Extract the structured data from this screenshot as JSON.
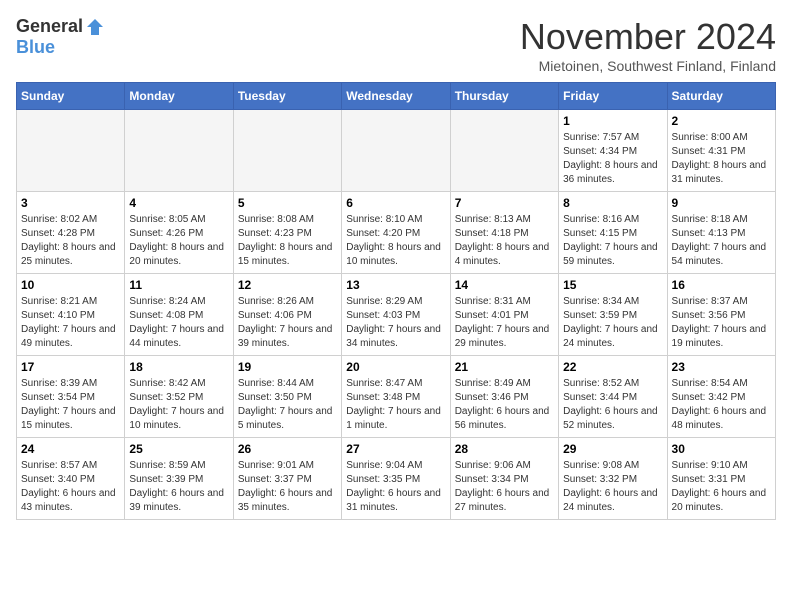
{
  "header": {
    "logo_general": "General",
    "logo_blue": "Blue",
    "month_title": "November 2024",
    "location": "Mietoinen, Southwest Finland, Finland"
  },
  "weekdays": [
    "Sunday",
    "Monday",
    "Tuesday",
    "Wednesday",
    "Thursday",
    "Friday",
    "Saturday"
  ],
  "weeks": [
    [
      {
        "day": "",
        "content": ""
      },
      {
        "day": "",
        "content": ""
      },
      {
        "day": "",
        "content": ""
      },
      {
        "day": "",
        "content": ""
      },
      {
        "day": "",
        "content": ""
      },
      {
        "day": "1",
        "content": "Sunrise: 7:57 AM\nSunset: 4:34 PM\nDaylight: 8 hours and 36 minutes."
      },
      {
        "day": "2",
        "content": "Sunrise: 8:00 AM\nSunset: 4:31 PM\nDaylight: 8 hours and 31 minutes."
      }
    ],
    [
      {
        "day": "3",
        "content": "Sunrise: 8:02 AM\nSunset: 4:28 PM\nDaylight: 8 hours and 25 minutes."
      },
      {
        "day": "4",
        "content": "Sunrise: 8:05 AM\nSunset: 4:26 PM\nDaylight: 8 hours and 20 minutes."
      },
      {
        "day": "5",
        "content": "Sunrise: 8:08 AM\nSunset: 4:23 PM\nDaylight: 8 hours and 15 minutes."
      },
      {
        "day": "6",
        "content": "Sunrise: 8:10 AM\nSunset: 4:20 PM\nDaylight: 8 hours and 10 minutes."
      },
      {
        "day": "7",
        "content": "Sunrise: 8:13 AM\nSunset: 4:18 PM\nDaylight: 8 hours and 4 minutes."
      },
      {
        "day": "8",
        "content": "Sunrise: 8:16 AM\nSunset: 4:15 PM\nDaylight: 7 hours and 59 minutes."
      },
      {
        "day": "9",
        "content": "Sunrise: 8:18 AM\nSunset: 4:13 PM\nDaylight: 7 hours and 54 minutes."
      }
    ],
    [
      {
        "day": "10",
        "content": "Sunrise: 8:21 AM\nSunset: 4:10 PM\nDaylight: 7 hours and 49 minutes."
      },
      {
        "day": "11",
        "content": "Sunrise: 8:24 AM\nSunset: 4:08 PM\nDaylight: 7 hours and 44 minutes."
      },
      {
        "day": "12",
        "content": "Sunrise: 8:26 AM\nSunset: 4:06 PM\nDaylight: 7 hours and 39 minutes."
      },
      {
        "day": "13",
        "content": "Sunrise: 8:29 AM\nSunset: 4:03 PM\nDaylight: 7 hours and 34 minutes."
      },
      {
        "day": "14",
        "content": "Sunrise: 8:31 AM\nSunset: 4:01 PM\nDaylight: 7 hours and 29 minutes."
      },
      {
        "day": "15",
        "content": "Sunrise: 8:34 AM\nSunset: 3:59 PM\nDaylight: 7 hours and 24 minutes."
      },
      {
        "day": "16",
        "content": "Sunrise: 8:37 AM\nSunset: 3:56 PM\nDaylight: 7 hours and 19 minutes."
      }
    ],
    [
      {
        "day": "17",
        "content": "Sunrise: 8:39 AM\nSunset: 3:54 PM\nDaylight: 7 hours and 15 minutes."
      },
      {
        "day": "18",
        "content": "Sunrise: 8:42 AM\nSunset: 3:52 PM\nDaylight: 7 hours and 10 minutes."
      },
      {
        "day": "19",
        "content": "Sunrise: 8:44 AM\nSunset: 3:50 PM\nDaylight: 7 hours and 5 minutes."
      },
      {
        "day": "20",
        "content": "Sunrise: 8:47 AM\nSunset: 3:48 PM\nDaylight: 7 hours and 1 minute."
      },
      {
        "day": "21",
        "content": "Sunrise: 8:49 AM\nSunset: 3:46 PM\nDaylight: 6 hours and 56 minutes."
      },
      {
        "day": "22",
        "content": "Sunrise: 8:52 AM\nSunset: 3:44 PM\nDaylight: 6 hours and 52 minutes."
      },
      {
        "day": "23",
        "content": "Sunrise: 8:54 AM\nSunset: 3:42 PM\nDaylight: 6 hours and 48 minutes."
      }
    ],
    [
      {
        "day": "24",
        "content": "Sunrise: 8:57 AM\nSunset: 3:40 PM\nDaylight: 6 hours and 43 minutes."
      },
      {
        "day": "25",
        "content": "Sunrise: 8:59 AM\nSunset: 3:39 PM\nDaylight: 6 hours and 39 minutes."
      },
      {
        "day": "26",
        "content": "Sunrise: 9:01 AM\nSunset: 3:37 PM\nDaylight: 6 hours and 35 minutes."
      },
      {
        "day": "27",
        "content": "Sunrise: 9:04 AM\nSunset: 3:35 PM\nDaylight: 6 hours and 31 minutes."
      },
      {
        "day": "28",
        "content": "Sunrise: 9:06 AM\nSunset: 3:34 PM\nDaylight: 6 hours and 27 minutes."
      },
      {
        "day": "29",
        "content": "Sunrise: 9:08 AM\nSunset: 3:32 PM\nDaylight: 6 hours and 24 minutes."
      },
      {
        "day": "30",
        "content": "Sunrise: 9:10 AM\nSunset: 3:31 PM\nDaylight: 6 hours and 20 minutes."
      }
    ]
  ]
}
